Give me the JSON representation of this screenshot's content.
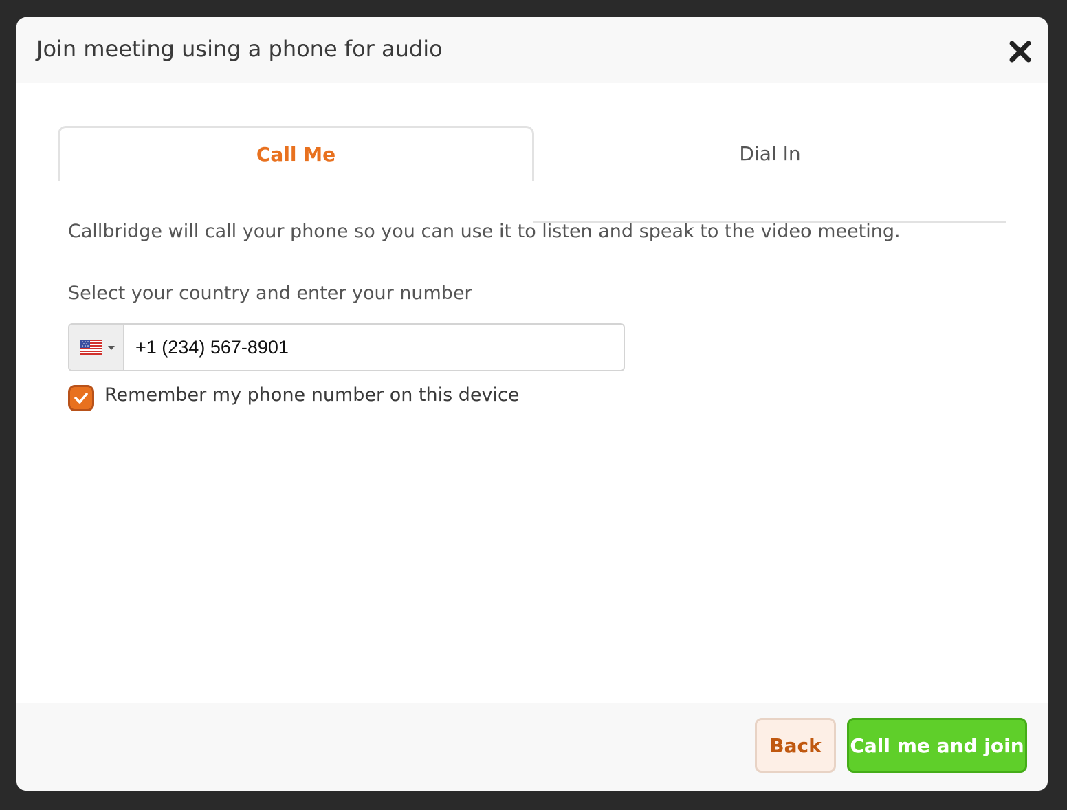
{
  "dialog": {
    "title": "Join meeting using a phone for audio",
    "close_icon": "close-icon"
  },
  "tabs": [
    {
      "label": "Call Me",
      "active": true
    },
    {
      "label": "Dial In",
      "active": false
    }
  ],
  "call_me": {
    "description": "Callbridge will call your phone so you can use it to listen and speak to the video meeting.",
    "field_label": "Select your country and enter your number",
    "country_flag_icon": "us-flag-icon",
    "phone_value": "+1 (234) 567-8901",
    "remember_checked": true,
    "remember_label": "Remember my phone number on this device"
  },
  "footer": {
    "back_label": "Back",
    "join_label": "Call me and join"
  },
  "colors": {
    "accent_orange": "#e8711f",
    "join_green": "#5fcf2a",
    "backdrop": "#2a2a2a"
  }
}
